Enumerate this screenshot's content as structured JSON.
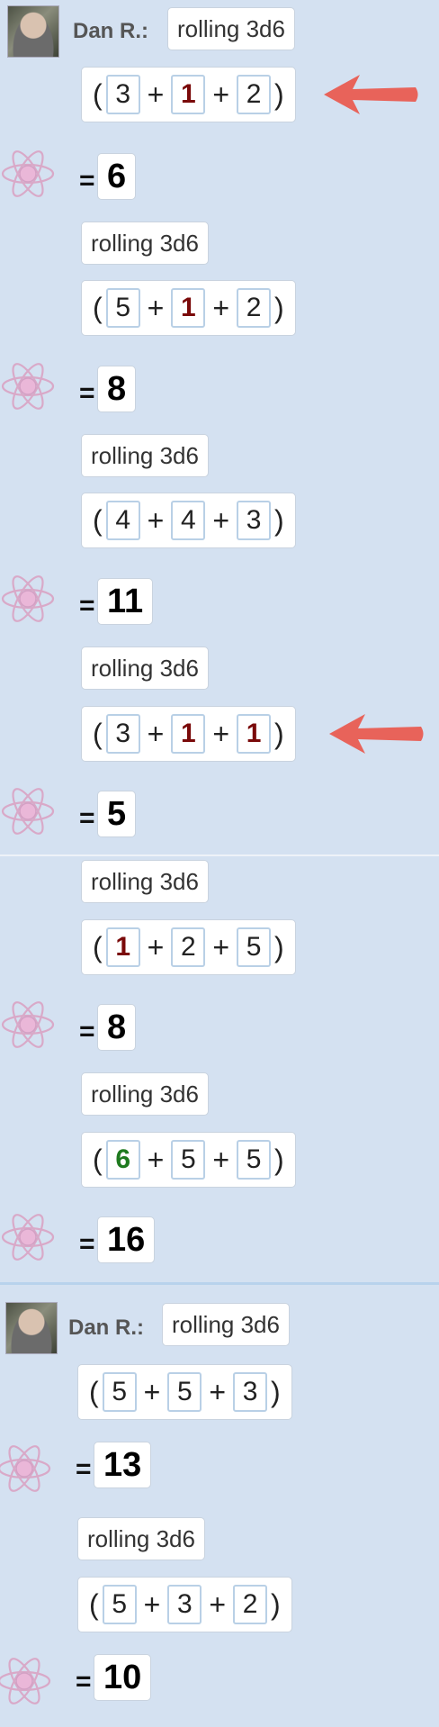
{
  "user": {
    "name": "Dan R.:"
  },
  "equals": "=",
  "paren_open": "(",
  "paren_close": ")",
  "plus": "+",
  "colors": {
    "background": "#d4e1f1",
    "min_die": "#7a0a0a",
    "max_die": "#1f7a1f",
    "arrow": "#e8635a"
  },
  "rolls": [
    {
      "command": "rolling 3d6",
      "dice": [
        {
          "v": "3",
          "k": ""
        },
        {
          "v": "1",
          "k": "min"
        },
        {
          "v": "2",
          "k": ""
        }
      ],
      "total": "6"
    },
    {
      "command": "rolling 3d6",
      "dice": [
        {
          "v": "5",
          "k": ""
        },
        {
          "v": "1",
          "k": "min"
        },
        {
          "v": "2",
          "k": ""
        }
      ],
      "total": "8"
    },
    {
      "command": "rolling 3d6",
      "dice": [
        {
          "v": "4",
          "k": ""
        },
        {
          "v": "4",
          "k": ""
        },
        {
          "v": "3",
          "k": ""
        }
      ],
      "total": "11"
    },
    {
      "command": "rolling 3d6",
      "dice": [
        {
          "v": "3",
          "k": ""
        },
        {
          "v": "1",
          "k": "min"
        },
        {
          "v": "1",
          "k": "min"
        }
      ],
      "total": "5"
    },
    {
      "command": "rolling 3d6",
      "dice": [
        {
          "v": "1",
          "k": "min"
        },
        {
          "v": "2",
          "k": ""
        },
        {
          "v": "5",
          "k": ""
        }
      ],
      "total": "8"
    },
    {
      "command": "rolling 3d6",
      "dice": [
        {
          "v": "6",
          "k": "max"
        },
        {
          "v": "5",
          "k": ""
        },
        {
          "v": "5",
          "k": ""
        }
      ],
      "total": "16"
    },
    {
      "command": "rolling 3d6",
      "dice": [
        {
          "v": "5",
          "k": ""
        },
        {
          "v": "5",
          "k": ""
        },
        {
          "v": "3",
          "k": ""
        }
      ],
      "total": "13"
    },
    {
      "command": "rolling 3d6",
      "dice": [
        {
          "v": "5",
          "k": ""
        },
        {
          "v": "3",
          "k": ""
        },
        {
          "v": "2",
          "k": ""
        }
      ],
      "total": "10"
    }
  ]
}
